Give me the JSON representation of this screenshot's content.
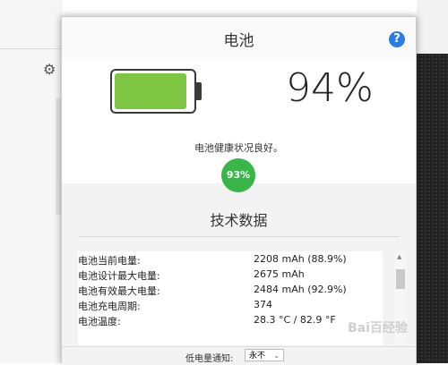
{
  "dialog": {
    "title": "电池",
    "help_icon": "?",
    "battery": {
      "level": 0.94,
      "fill_color": "#7ec544"
    },
    "percent": "94%",
    "health_text": "电池健康状况良好。",
    "health_value": "93%",
    "section_title": "技术数据",
    "tech_rows": [
      {
        "key": "电池当前电量:",
        "value": "2208 mAh (88.9%)"
      },
      {
        "key": "电池设计最大电量:",
        "value": "2675 mAh"
      },
      {
        "key": "电池有效最大电量:",
        "value": "2484 mAh (92.9%)"
      },
      {
        "key": "电池充电周期:",
        "value": "374"
      },
      {
        "key": "电池温度:",
        "value": "28.3 °C / 82.9 °F"
      }
    ],
    "footer": {
      "label": "低电量通知:",
      "select_value": "永不"
    }
  },
  "watermark": "Bai百经验"
}
